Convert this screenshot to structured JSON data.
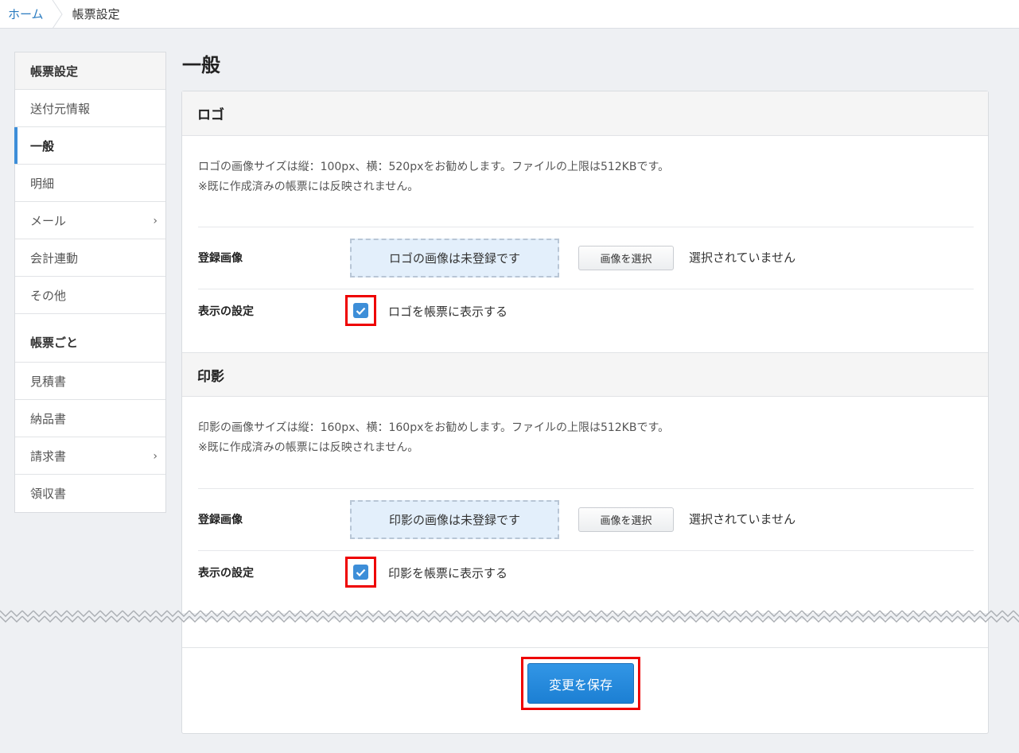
{
  "breadcrumb": {
    "home": "ホーム",
    "current": "帳票設定"
  },
  "sidebar": {
    "group1_title": "帳票設定",
    "group1_items": [
      {
        "label": "送付元情報",
        "active": false,
        "chevron": false
      },
      {
        "label": "一般",
        "active": true,
        "chevron": false
      },
      {
        "label": "明細",
        "active": false,
        "chevron": false
      },
      {
        "label": "メール",
        "active": false,
        "chevron": true
      },
      {
        "label": "会計連動",
        "active": false,
        "chevron": false
      },
      {
        "label": "その他",
        "active": false,
        "chevron": false
      }
    ],
    "group2_title": "帳票ごと",
    "group2_items": [
      {
        "label": "見積書",
        "chevron": false
      },
      {
        "label": "納品書",
        "chevron": false
      },
      {
        "label": "請求書",
        "chevron": true
      },
      {
        "label": "領収書",
        "chevron": false
      }
    ],
    "chevron_glyph": "›"
  },
  "main": {
    "title": "一般",
    "logo": {
      "heading": "ロゴ",
      "note1": "ロゴの画像サイズは縦：100px、横：520pxをお勧めします。ファイルの上限は512KBです。",
      "note2": "※既に作成済みの帳票には反映されません。",
      "image_label": "登録画像",
      "dropzone_text": "ロゴの画像は未登録です",
      "choose_button": "画像を選択",
      "no_file": "選択されていません",
      "display_label": "表示の設定",
      "checkbox_label": "ロゴを帳票に表示する",
      "checked": true
    },
    "stamp": {
      "heading": "印影",
      "note1": "印影の画像サイズは縦：160px、横：160pxをお勧めします。ファイルの上限は512KBです。",
      "note2": "※既に作成済みの帳票には反映されません。",
      "image_label": "登録画像",
      "dropzone_text": "印影の画像は未登録です",
      "choose_button": "画像を選択",
      "no_file": "選択されていません",
      "display_label": "表示の設定",
      "checkbox_label": "印影を帳票に表示する",
      "checked": true
    },
    "save_button": "変更を保存"
  },
  "colors": {
    "accent": "#3d8ed8",
    "highlight": "#ee0000",
    "link": "#2a7bc0"
  }
}
